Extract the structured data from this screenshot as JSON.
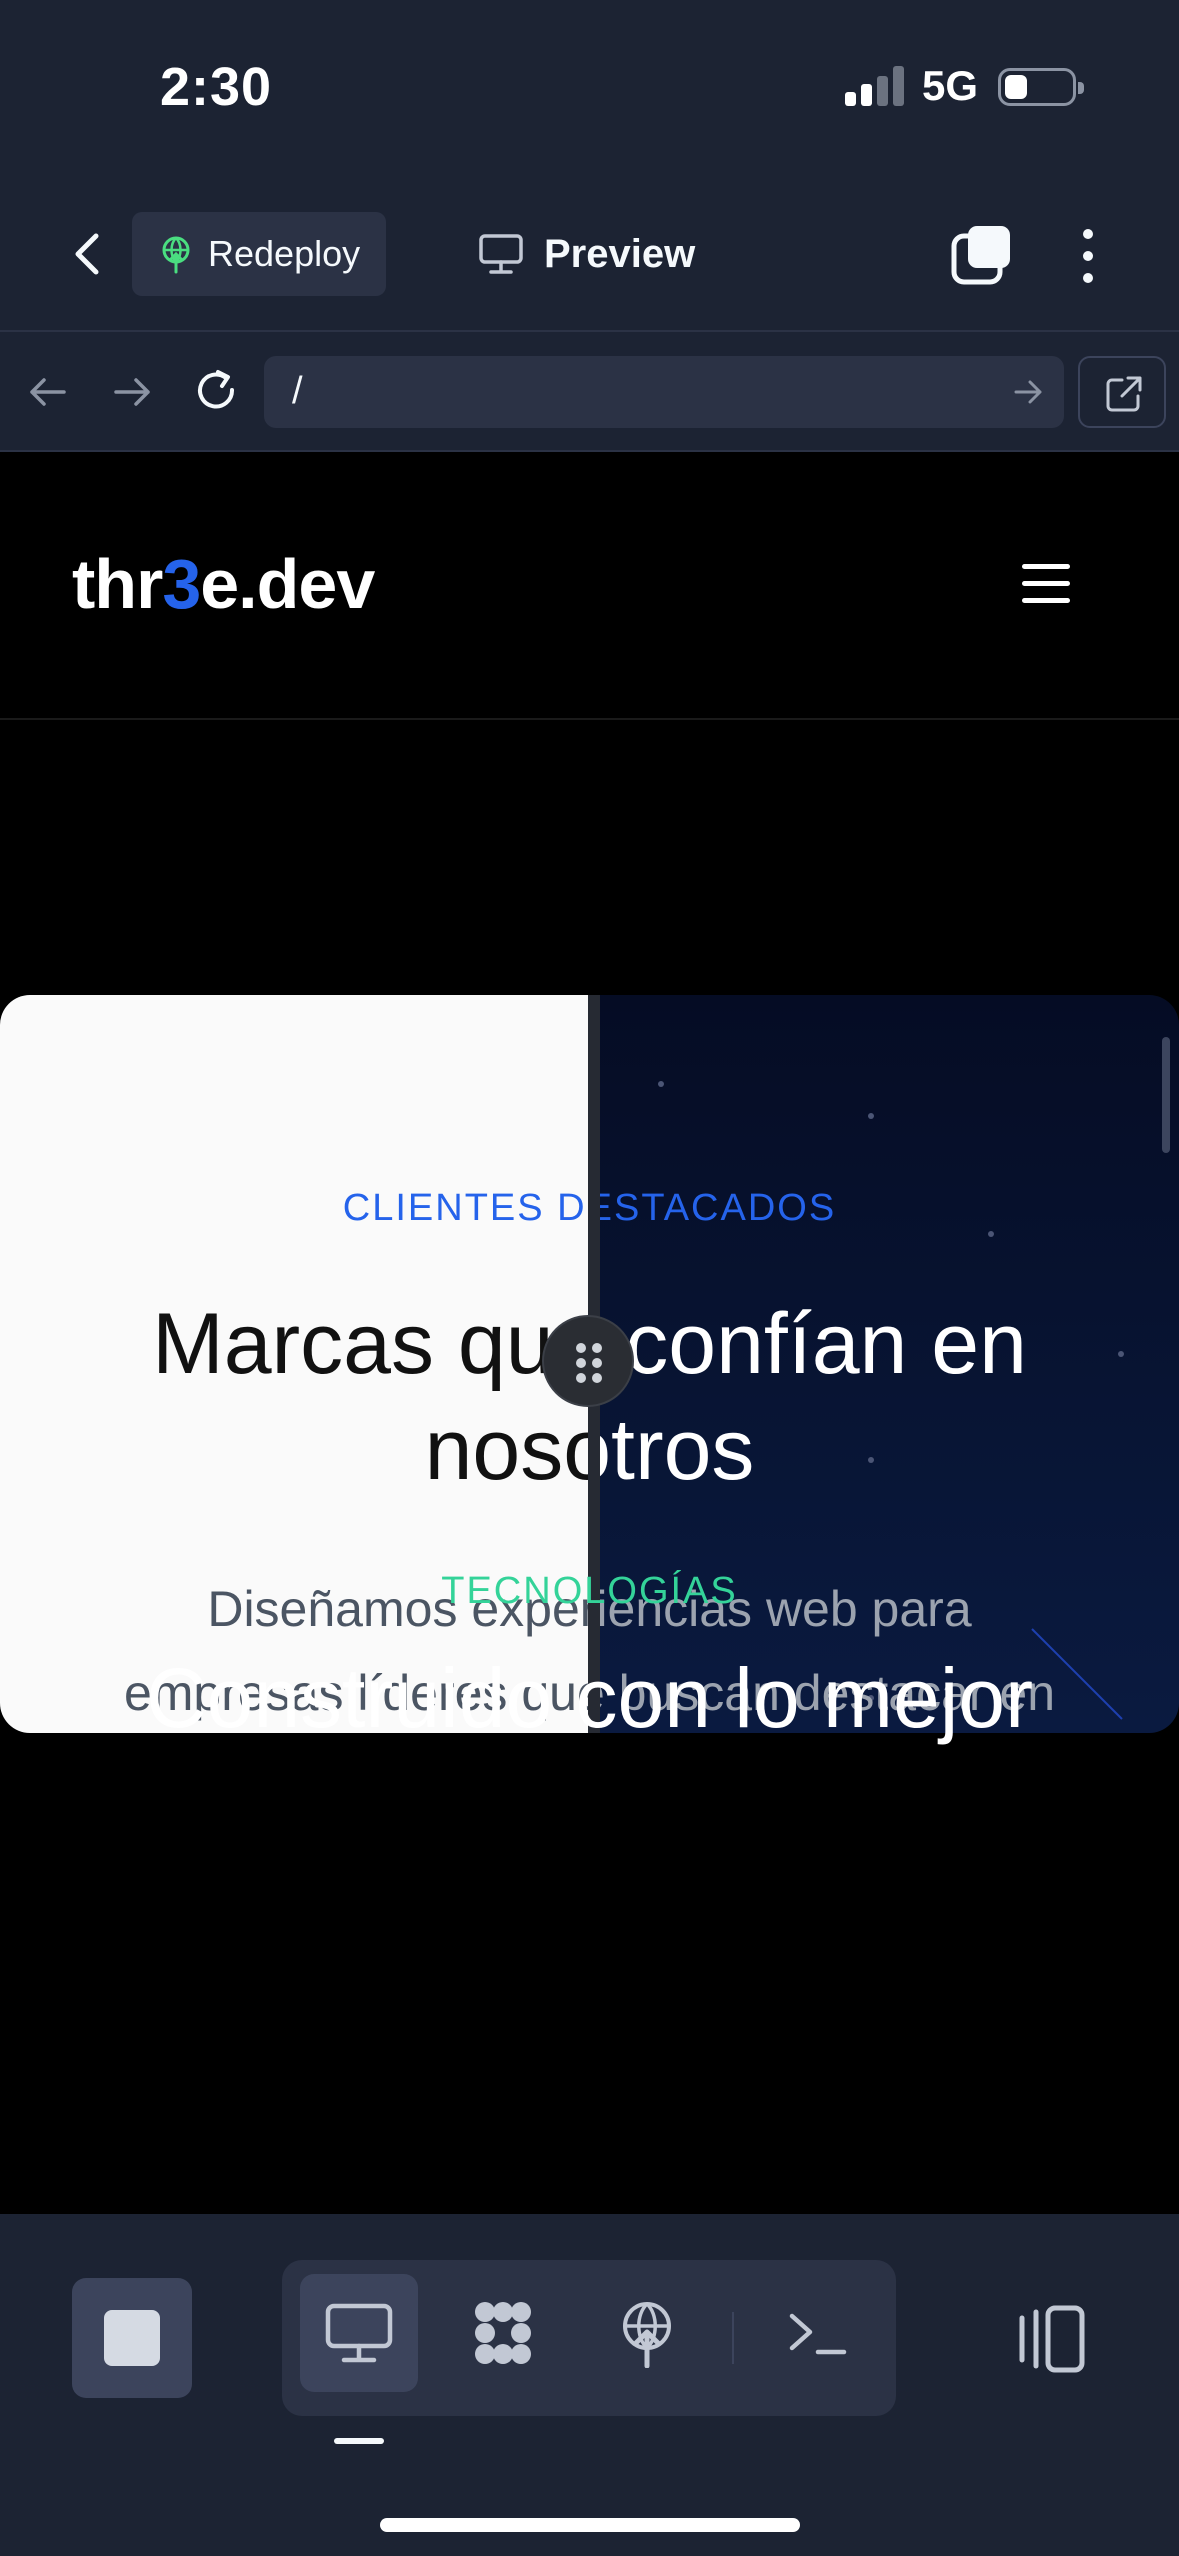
{
  "status_bar": {
    "time": "2:30",
    "network": "5G"
  },
  "header": {
    "redeploy_label": "Redeploy",
    "preview_label": "Preview"
  },
  "url_bar": {
    "url": "/"
  },
  "site": {
    "logo_pre": "thr",
    "logo_accent": "3",
    "logo_post": "e.dev",
    "clients": {
      "eyebrow": "CLIENTES DESTACADOS",
      "headline_line1": "Marcas que confían en",
      "headline_line2": "nosotros",
      "sub_line1": "Diseñamos experiencias web para",
      "sub_line2": "empresas líderes que buscan destacar en"
    },
    "tech": {
      "eyebrow": "TECNOLOGÍAS",
      "title": "Construido con lo mejor"
    }
  },
  "colors": {
    "ide_bg": "#1c2333",
    "accent_blue": "#2563eb",
    "accent_green": "#34d399",
    "redeploy_icon": "#4ade80"
  },
  "icons": [
    "back-chevron-icon",
    "redeploy-icon",
    "monitor-icon",
    "tabs-icon",
    "kebab-icon",
    "arrow-left-icon",
    "arrow-right-icon",
    "reload-icon",
    "open-external-icon",
    "hamburger-icon",
    "drag-handle-icon",
    "stop-icon",
    "preview-monitor-icon",
    "extensions-icon",
    "deployments-icon",
    "shell-icon",
    "panels-icon"
  ]
}
